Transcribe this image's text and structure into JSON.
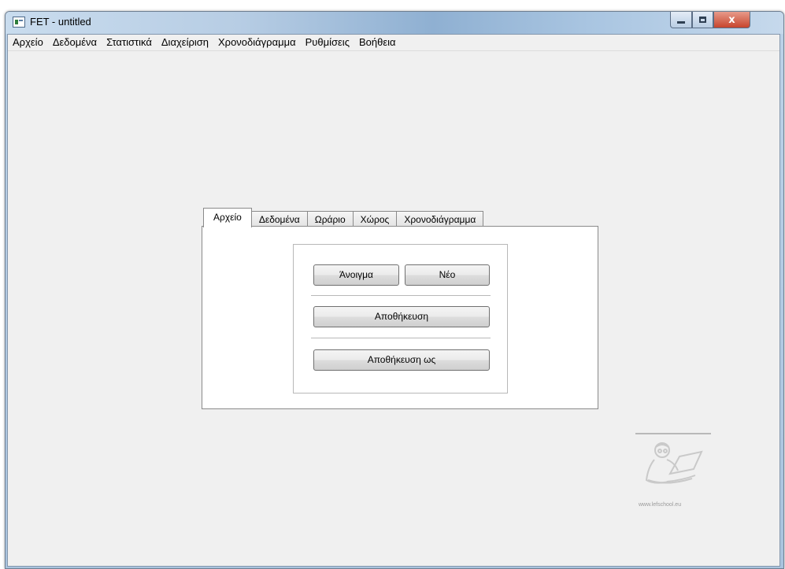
{
  "window": {
    "title": "FET - untitled",
    "caption_close": "x"
  },
  "menubar": {
    "items": [
      {
        "label": "Αρχείο"
      },
      {
        "label": "Δεδομένα"
      },
      {
        "label": "Στατιστικά"
      },
      {
        "label": "Διαχείριση"
      },
      {
        "label": "Χρονοδιάγραμμα"
      },
      {
        "label": "Ρυθμίσεις"
      },
      {
        "label": "Βοήθεια"
      }
    ]
  },
  "tabs": {
    "active": "Αρχείο",
    "items": [
      {
        "label": "Αρχείο"
      },
      {
        "label": "Δεδομένα"
      },
      {
        "label": "Ωράριο"
      },
      {
        "label": "Χώρος"
      },
      {
        "label": "Χρονοδιάγραμμα"
      }
    ]
  },
  "file_panel": {
    "open_label": "Άνοιγμα",
    "new_label": "Νέο",
    "save_label": "Αποθήκευση",
    "save_as_label": "Αποθήκευση ως"
  },
  "logo": {
    "icon": "teacher-at-laptop-logo",
    "text": "www.lefschool.eu"
  },
  "colors": {
    "client_background": "#f0f0f0",
    "close_button": "#c7452d",
    "titlebar": "#b7cde4"
  }
}
